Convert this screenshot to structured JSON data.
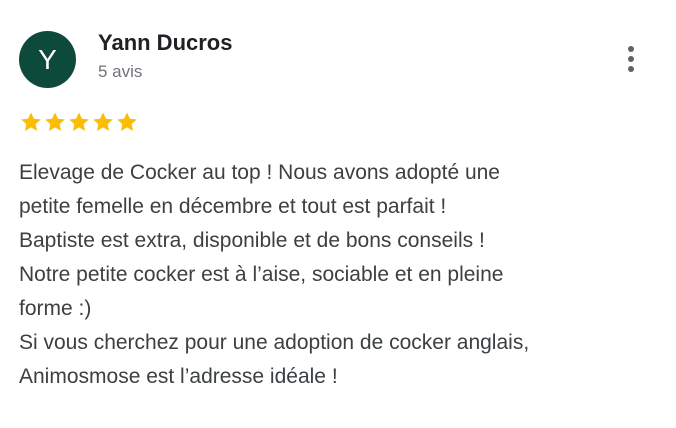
{
  "review": {
    "author": {
      "initial": "Y",
      "name": "Yann Ducros",
      "review_count": "5 avis",
      "avatar_color": "#0d4a3b"
    },
    "more_options_icon": "more-vert-icon",
    "rating": {
      "stars": 5,
      "max": 5,
      "star_color": "#fbbc04",
      "star_icon": "star-icon"
    },
    "text": "Elevage de Cocker au top ! Nous avons adopté une\npetite femelle en décembre et tout est parfait !\nBaptiste est extra, disponible et de bons conseils !\nNotre petite cocker est à l’aise, sociable et en pleine\nforme :)\nSi vous cherchez pour une adoption de cocker anglais,\nAnimosmose est l’adresse idéale !"
  }
}
